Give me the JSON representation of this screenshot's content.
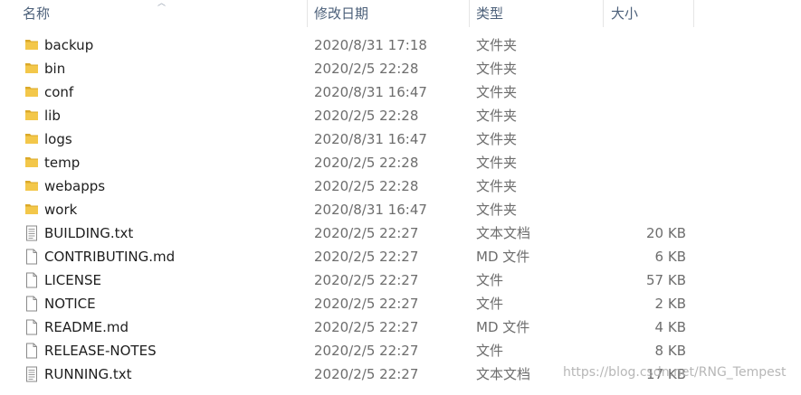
{
  "columns": {
    "name": "名称",
    "modified": "修改日期",
    "type": "类型",
    "size": "大小"
  },
  "colors": {
    "folder": "#f3c74a",
    "folder_dark": "#dba929",
    "header_text": "#4c607a",
    "secondary_text": "#6d6d6d"
  },
  "files": [
    {
      "name": "backup",
      "modified": "2020/8/31 17:18",
      "type": "文件夹",
      "size": "",
      "icon": "folder-icon"
    },
    {
      "name": "bin",
      "modified": "2020/2/5 22:28",
      "type": "文件夹",
      "size": "",
      "icon": "folder-icon"
    },
    {
      "name": "conf",
      "modified": "2020/8/31 16:47",
      "type": "文件夹",
      "size": "",
      "icon": "folder-icon"
    },
    {
      "name": "lib",
      "modified": "2020/2/5 22:28",
      "type": "文件夹",
      "size": "",
      "icon": "folder-icon"
    },
    {
      "name": "logs",
      "modified": "2020/8/31 16:47",
      "type": "文件夹",
      "size": "",
      "icon": "folder-icon"
    },
    {
      "name": "temp",
      "modified": "2020/2/5 22:28",
      "type": "文件夹",
      "size": "",
      "icon": "folder-icon"
    },
    {
      "name": "webapps",
      "modified": "2020/2/5 22:28",
      "type": "文件夹",
      "size": "",
      "icon": "folder-icon"
    },
    {
      "name": "work",
      "modified": "2020/8/31 16:47",
      "type": "文件夹",
      "size": "",
      "icon": "folder-icon"
    },
    {
      "name": "BUILDING.txt",
      "modified": "2020/2/5 22:27",
      "type": "文本文档",
      "size": "20 KB",
      "icon": "text-file-icon"
    },
    {
      "name": "CONTRIBUTING.md",
      "modified": "2020/2/5 22:27",
      "type": "MD 文件",
      "size": "6 KB",
      "icon": "file-icon"
    },
    {
      "name": "LICENSE",
      "modified": "2020/2/5 22:27",
      "type": "文件",
      "size": "57 KB",
      "icon": "file-icon"
    },
    {
      "name": "NOTICE",
      "modified": "2020/2/5 22:27",
      "type": "文件",
      "size": "2 KB",
      "icon": "file-icon"
    },
    {
      "name": "README.md",
      "modified": "2020/2/5 22:27",
      "type": "MD 文件",
      "size": "4 KB",
      "icon": "file-icon"
    },
    {
      "name": "RELEASE-NOTES",
      "modified": "2020/2/5 22:27",
      "type": "文件",
      "size": "8 KB",
      "icon": "file-icon"
    },
    {
      "name": "RUNNING.txt",
      "modified": "2020/2/5 22:27",
      "type": "文本文档",
      "size": "17 KB",
      "icon": "text-file-icon"
    }
  ],
  "watermark": "https://blog.csdn.net/RNG_Tempest"
}
